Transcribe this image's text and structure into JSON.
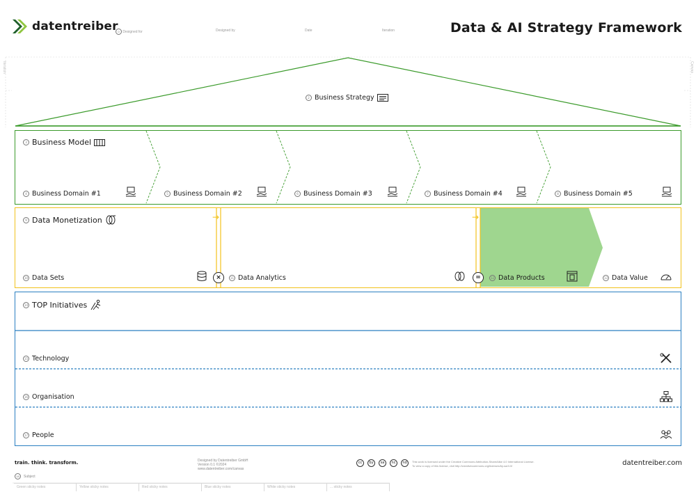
{
  "header": {
    "logo_text": "datentreiber",
    "meta_fields": [
      "Designed for",
      "Designed by",
      "Date",
      "Iteration"
    ],
    "title": "Data & AI Strategy Framework"
  },
  "side_labels": {
    "left": "Iteration",
    "right": "Canvas"
  },
  "business_strategy": {
    "label": "Business Strategy"
  },
  "business_model": {
    "label": "Business Model",
    "domains": [
      "Business Domain #1",
      "Business Domain #2",
      "Business Domain #3",
      "Business Domain #4",
      "Business Domain #5"
    ]
  },
  "data_monetization": {
    "label": "Data Monetization",
    "stages": [
      "Data Sets",
      "Data Analytics",
      "Data Products",
      "Data Value"
    ],
    "operators": [
      "×",
      "="
    ],
    "highlight_color": "#9fd68f"
  },
  "top_initiatives": {
    "label": "TOP Initiatives",
    "rows": [
      "Technology",
      "Organisation",
      "People"
    ]
  },
  "footer": {
    "slogan": "train. think. transform.",
    "credits_line1": "Designed by Datentreiber GmbH",
    "credits_line2": "Version 0.1 ©2024",
    "credits_line3": "www.datentreiber.com/canvas",
    "license_line1": "This work is licensed under the Creative Commons Attribution-ShareAlike 4.0 International License.",
    "license_line2": "To view a copy of this license, visit http://creativecommons.org/licenses/by-sa/4.0/",
    "license_icons": [
      "cc",
      "by",
      "sa",
      "nc",
      "nd"
    ],
    "site": "datentreiber.com",
    "legend_label": "Subject",
    "legend_items": [
      "Green sticky notes",
      "Yellow sticky notes",
      "Red sticky notes",
      "Blue sticky notes",
      "White sticky notes",
      "... sticky notes"
    ]
  },
  "colors": {
    "green": "#3a9a2a",
    "yellow": "#f2c21b",
    "blue": "#2a7fc1"
  }
}
